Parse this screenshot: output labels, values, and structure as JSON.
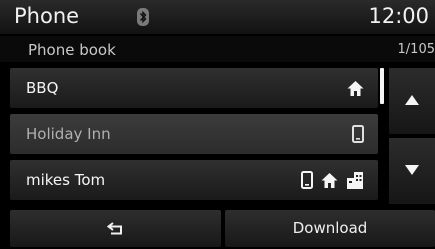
{
  "status_bar": {
    "title": "Phone",
    "clock": "12:00",
    "bluetooth_icon": "bluetooth-icon"
  },
  "sub_header": {
    "title": "Phone book",
    "page_indicator": "1/105"
  },
  "contacts": [
    {
      "name": "BBQ",
      "icons": [
        "home-icon"
      ],
      "highlighted": false
    },
    {
      "name": "Holiday Inn",
      "icons": [
        "mobile-phone-icon"
      ],
      "highlighted": true
    },
    {
      "name": "mikes Tom",
      "icons": [
        "mobile-phone-icon",
        "home-icon",
        "office-icon"
      ],
      "highlighted": false
    }
  ],
  "scroll": {
    "up_icon": "triangle-up-icon",
    "down_icon": "triangle-down-icon"
  },
  "bottom_bar": {
    "back_icon": "back-arrow-icon",
    "download_label": "Download"
  },
  "colors": {
    "background": "#000000",
    "text": "#f5f5f5",
    "highlight_text": "#b0b0b0"
  }
}
